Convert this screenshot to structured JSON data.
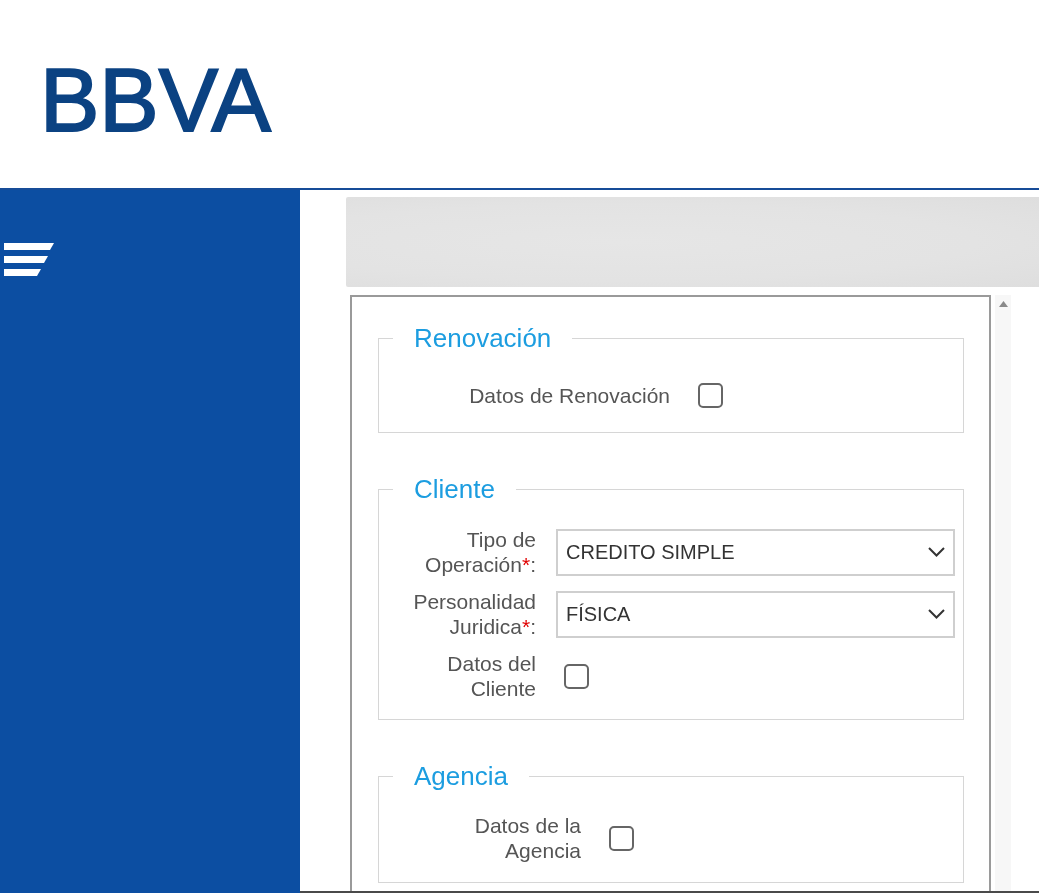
{
  "header": {
    "logo": "BBVA"
  },
  "form": {
    "sections": [
      {
        "legend": "Renovación",
        "fields": [
          {
            "kind": "checkbox",
            "label": "Datos de Renovación",
            "checked": false
          }
        ]
      },
      {
        "legend": "Cliente",
        "fields": [
          {
            "kind": "select",
            "label": "Tipo de Operación",
            "required_mark": "*",
            "suffix": ":",
            "value": "CREDITO SIMPLE"
          },
          {
            "kind": "select",
            "label": "Personalidad Juridica",
            "required_mark": "*",
            "suffix": ":",
            "value": "FÍSICA"
          },
          {
            "kind": "checkbox",
            "label": "Datos del Cliente",
            "checked": false
          }
        ]
      },
      {
        "legend": "Agencia",
        "fields": [
          {
            "kind": "checkbox",
            "label": "Datos de la Agencia",
            "checked": false
          }
        ]
      }
    ]
  }
}
